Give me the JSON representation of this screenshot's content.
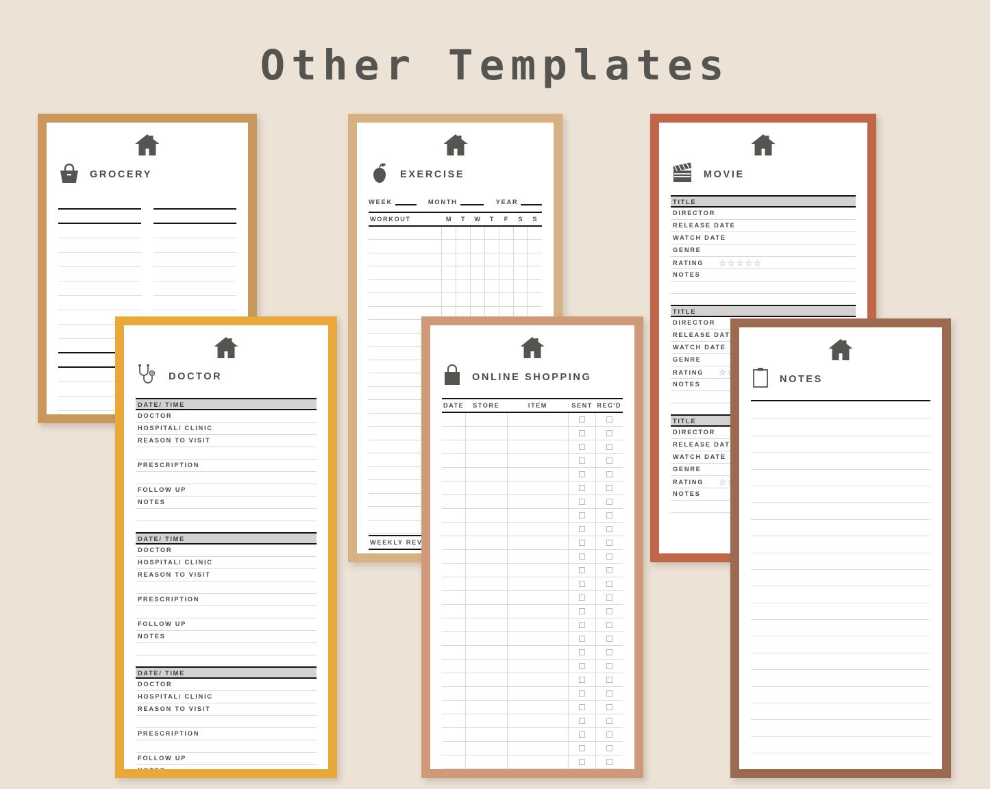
{
  "page": {
    "title": "Other Templates",
    "background_color": "#ece2d6",
    "title_color": "#565451"
  },
  "cards": [
    {
      "id": "grocery",
      "name": "GROCERY",
      "icon": "basket-icon",
      "header_icon": "house-icon",
      "frame_color": "#c8985c",
      "layout": "two-column-lines",
      "columns": 2,
      "line_pattern": [
        "bold",
        "bold",
        "light",
        "light",
        "light",
        "light",
        "light",
        "light",
        "light",
        "light",
        "bold",
        "bold",
        "light",
        "light",
        "light",
        "light",
        "light",
        "light",
        "light",
        "light",
        "bold",
        "bold",
        "light",
        "light",
        "light"
      ]
    },
    {
      "id": "exercise",
      "name": "EXERCISE",
      "icon": "apple-icon",
      "header_icon": "house-icon",
      "frame_color": "#d7b083",
      "layout": "workout-grid",
      "fields": [
        {
          "label": "WEEK"
        },
        {
          "label": "MONTH"
        },
        {
          "label": "YEAR"
        }
      ],
      "table": {
        "first_column": "WORKOUT",
        "day_columns": [
          "M",
          "T",
          "W",
          "T",
          "F",
          "S",
          "S"
        ],
        "rows": 23
      },
      "footer_section": "WEEKLY REVIEW",
      "footer_lines": 5
    },
    {
      "id": "movie",
      "name": "MOVIE",
      "icon": "clapperboard-icon",
      "header_icon": "house-icon",
      "frame_color": "#c0674a",
      "layout": "repeated-field-blocks",
      "block_count": 3,
      "fields": [
        {
          "label": "TITLE",
          "style": "header"
        },
        {
          "label": "DIRECTOR",
          "style": "normal"
        },
        {
          "label": "RELEASE DATE",
          "style": "normal"
        },
        {
          "label": "WATCH DATE",
          "style": "normal"
        },
        {
          "label": "GENRE",
          "style": "normal"
        },
        {
          "label": "RATING",
          "style": "stars",
          "stars": 5,
          "star_glyph": "☆"
        },
        {
          "label": "NOTES",
          "style": "normal"
        },
        {
          "label": "",
          "style": "blank"
        }
      ]
    },
    {
      "id": "doctor",
      "name": "DOCTOR",
      "icon": "stethoscope-icon",
      "header_icon": "house-icon",
      "frame_color": "#e8a93c",
      "layout": "repeated-field-blocks",
      "block_count": 3,
      "fields": [
        {
          "label": "DATE/ TIME",
          "style": "header"
        },
        {
          "label": "DOCTOR",
          "style": "normal"
        },
        {
          "label": "HOSPITAL/ CLINIC",
          "style": "normal"
        },
        {
          "label": "REASON TO VISIT",
          "style": "normal"
        },
        {
          "label": "",
          "style": "blank"
        },
        {
          "label": "PRESCRIPTION",
          "style": "normal"
        },
        {
          "label": "",
          "style": "blank"
        },
        {
          "label": "FOLLOW UP",
          "style": "normal"
        },
        {
          "label": "NOTES",
          "style": "normal"
        },
        {
          "label": "",
          "style": "blank"
        }
      ]
    },
    {
      "id": "online-shopping",
      "name": "ONLINE SHOPPING",
      "icon": "shopping-bag-icon",
      "header_icon": "house-icon",
      "frame_color": "#cf9a7a",
      "layout": "shopping-table",
      "table": {
        "headers": [
          "DATE",
          "STORE",
          "ITEM",
          "SENT",
          "REC'D"
        ],
        "checkbox_columns": [
          "SENT",
          "REC'D"
        ],
        "rows": 26
      }
    },
    {
      "id": "notes",
      "name": "NOTES",
      "icon": "clipboard-icon",
      "header_icon": "house-icon",
      "frame_color": "#9b6a50",
      "layout": "ruled-lines",
      "line_count": 23
    }
  ]
}
